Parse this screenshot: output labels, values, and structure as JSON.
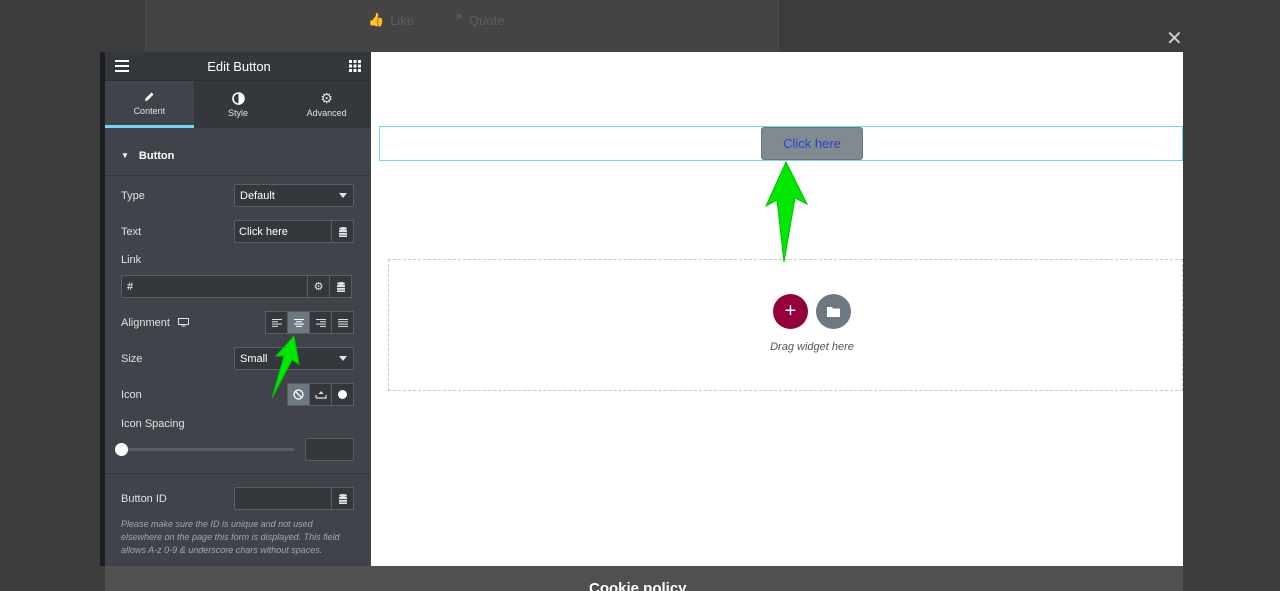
{
  "background": {
    "like_label": "Like",
    "quote_label": "Quote",
    "cookie_text": "Cookie policy"
  },
  "panel": {
    "title": "Edit Button",
    "tabs": [
      {
        "label": "Content",
        "icon": "pencil-icon",
        "active": true
      },
      {
        "label": "Style",
        "icon": "contrast-icon",
        "active": false
      },
      {
        "label": "Advanced",
        "icon": "gear-icon",
        "active": false
      }
    ],
    "section_title": "Button",
    "type": {
      "label": "Type",
      "value": "Default"
    },
    "text": {
      "label": "Text",
      "value": "Click here"
    },
    "link": {
      "label": "Link",
      "value": "#"
    },
    "alignment": {
      "label": "Alignment",
      "selected": "center"
    },
    "size": {
      "label": "Size",
      "value": "Small"
    },
    "icon": {
      "label": "Icon",
      "selected": "none"
    },
    "icon_spacing": {
      "label": "Icon Spacing",
      "value": ""
    },
    "button_id": {
      "label": "Button ID",
      "value": ""
    },
    "help_text": "Please make sure the ID is unique and not used elsewhere on the page this form is displayed. This field allows A-z  0-9 & underscore chars without spaces."
  },
  "preview": {
    "button_label": "Click here",
    "drag_hint": "Drag widget here"
  },
  "colors": {
    "accent": "#71d7f7",
    "add_button": "#93003c",
    "arrow": "#00e700"
  }
}
